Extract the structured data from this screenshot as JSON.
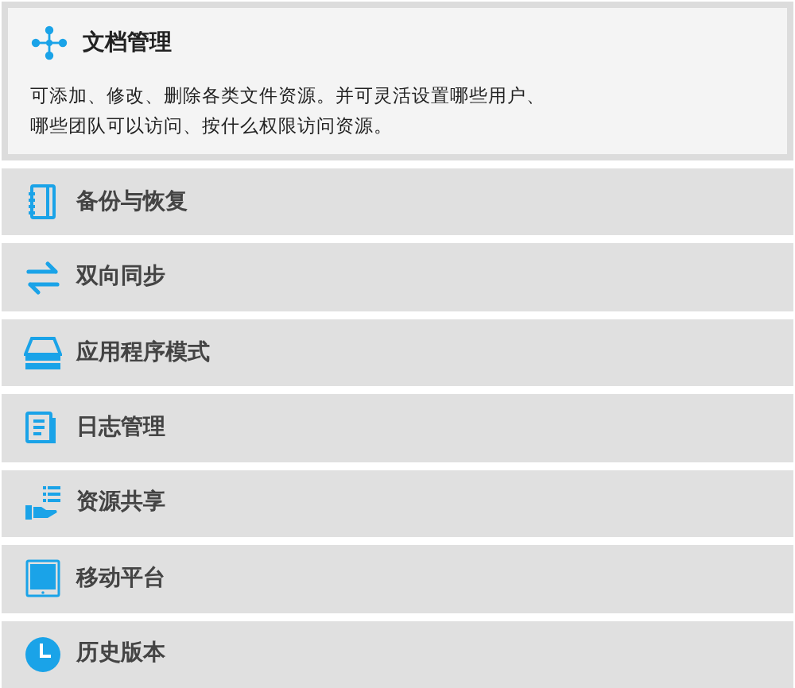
{
  "sections": [
    {
      "title": "文档管理",
      "expanded": true,
      "description": "可添加、修改、删除各类文件资源。并可灵活设置哪些用户、哪些团队可以访问、按什么权限访问资源。"
    },
    {
      "title": "备份与恢复",
      "expanded": false
    },
    {
      "title": "双向同步",
      "expanded": false
    },
    {
      "title": "应用程序模式",
      "expanded": false
    },
    {
      "title": "日志管理",
      "expanded": false
    },
    {
      "title": "资源共享",
      "expanded": false
    },
    {
      "title": "移动平台",
      "expanded": false
    },
    {
      "title": "历史版本",
      "expanded": false
    }
  ]
}
